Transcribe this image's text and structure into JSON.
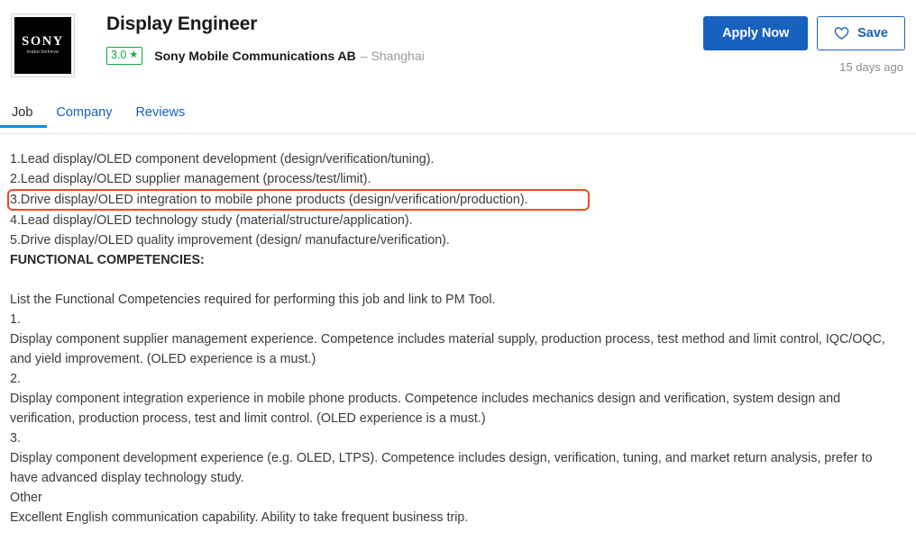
{
  "header": {
    "logo": {
      "name": "sony-logo",
      "wordmark": "SONY",
      "tagline": "make.believe"
    },
    "job_title": "Display Engineer",
    "rating": {
      "value": "3.0",
      "star": "★",
      "border_color": "#0caa41"
    },
    "employer_name": "Sony Mobile Communications AB",
    "separator": "–",
    "location": "Shanghai",
    "apply_label": "Apply Now",
    "save_label": "Save",
    "save_icon": "heart-outline-icon",
    "posted_date": "15 days ago",
    "accent_blue": "#1861bf"
  },
  "tabs": [
    {
      "label": "Job",
      "active": true
    },
    {
      "label": "Company",
      "active": false
    },
    {
      "label": "Reviews",
      "active": false
    }
  ],
  "tab_underline_color": "#0e8fd4",
  "highlight": {
    "color": "#f04a1e",
    "target_line_index": 2
  },
  "description": {
    "lines": [
      {
        "text": "1.Lead display/OLED component development (design/verification/tuning).",
        "style": "normal"
      },
      {
        "text": "2.Lead display/OLED supplier management (process/test/limit).",
        "style": "normal"
      },
      {
        "text": "3.Drive display/OLED integration to mobile phone products (design/verification/production).",
        "style": "highlighted"
      },
      {
        "text": "4.Lead display/OLED technology study (material/structure/application).",
        "style": "normal"
      },
      {
        "text": "5.Drive display/OLED quality improvement (design/ manufacture/verification).",
        "style": "normal"
      },
      {
        "text": "FUNCTIONAL COMPETENCIES:",
        "style": "bold"
      },
      {
        "text": "",
        "style": "spacer"
      },
      {
        "text": "List the Functional Competencies required for performing this job and link to PM Tool.",
        "style": "normal"
      },
      {
        "text": "1.",
        "style": "normal"
      },
      {
        "text": "Display component supplier management experience. Competence includes material supply, production process, test method and limit control, IQC/OQC, and yield improvement. (OLED experience is a must.)",
        "style": "paragraph"
      },
      {
        "text": "2.",
        "style": "normal"
      },
      {
        "text": "Display component integration experience in mobile phone products. Competence includes mechanics design and verification, system design and verification, production process, test and limit control. (OLED experience is a must.)",
        "style": "paragraph"
      },
      {
        "text": "3.",
        "style": "normal"
      },
      {
        "text": "Display component development experience (e.g. OLED, LTPS). Competence includes design, verification, tuning, and market return analysis, prefer to have advanced display technology study.",
        "style": "paragraph"
      },
      {
        "text": "Other",
        "style": "normal"
      },
      {
        "text": "Excellent English communication capability. Ability to take frequent business trip.",
        "style": "normal"
      }
    ]
  }
}
